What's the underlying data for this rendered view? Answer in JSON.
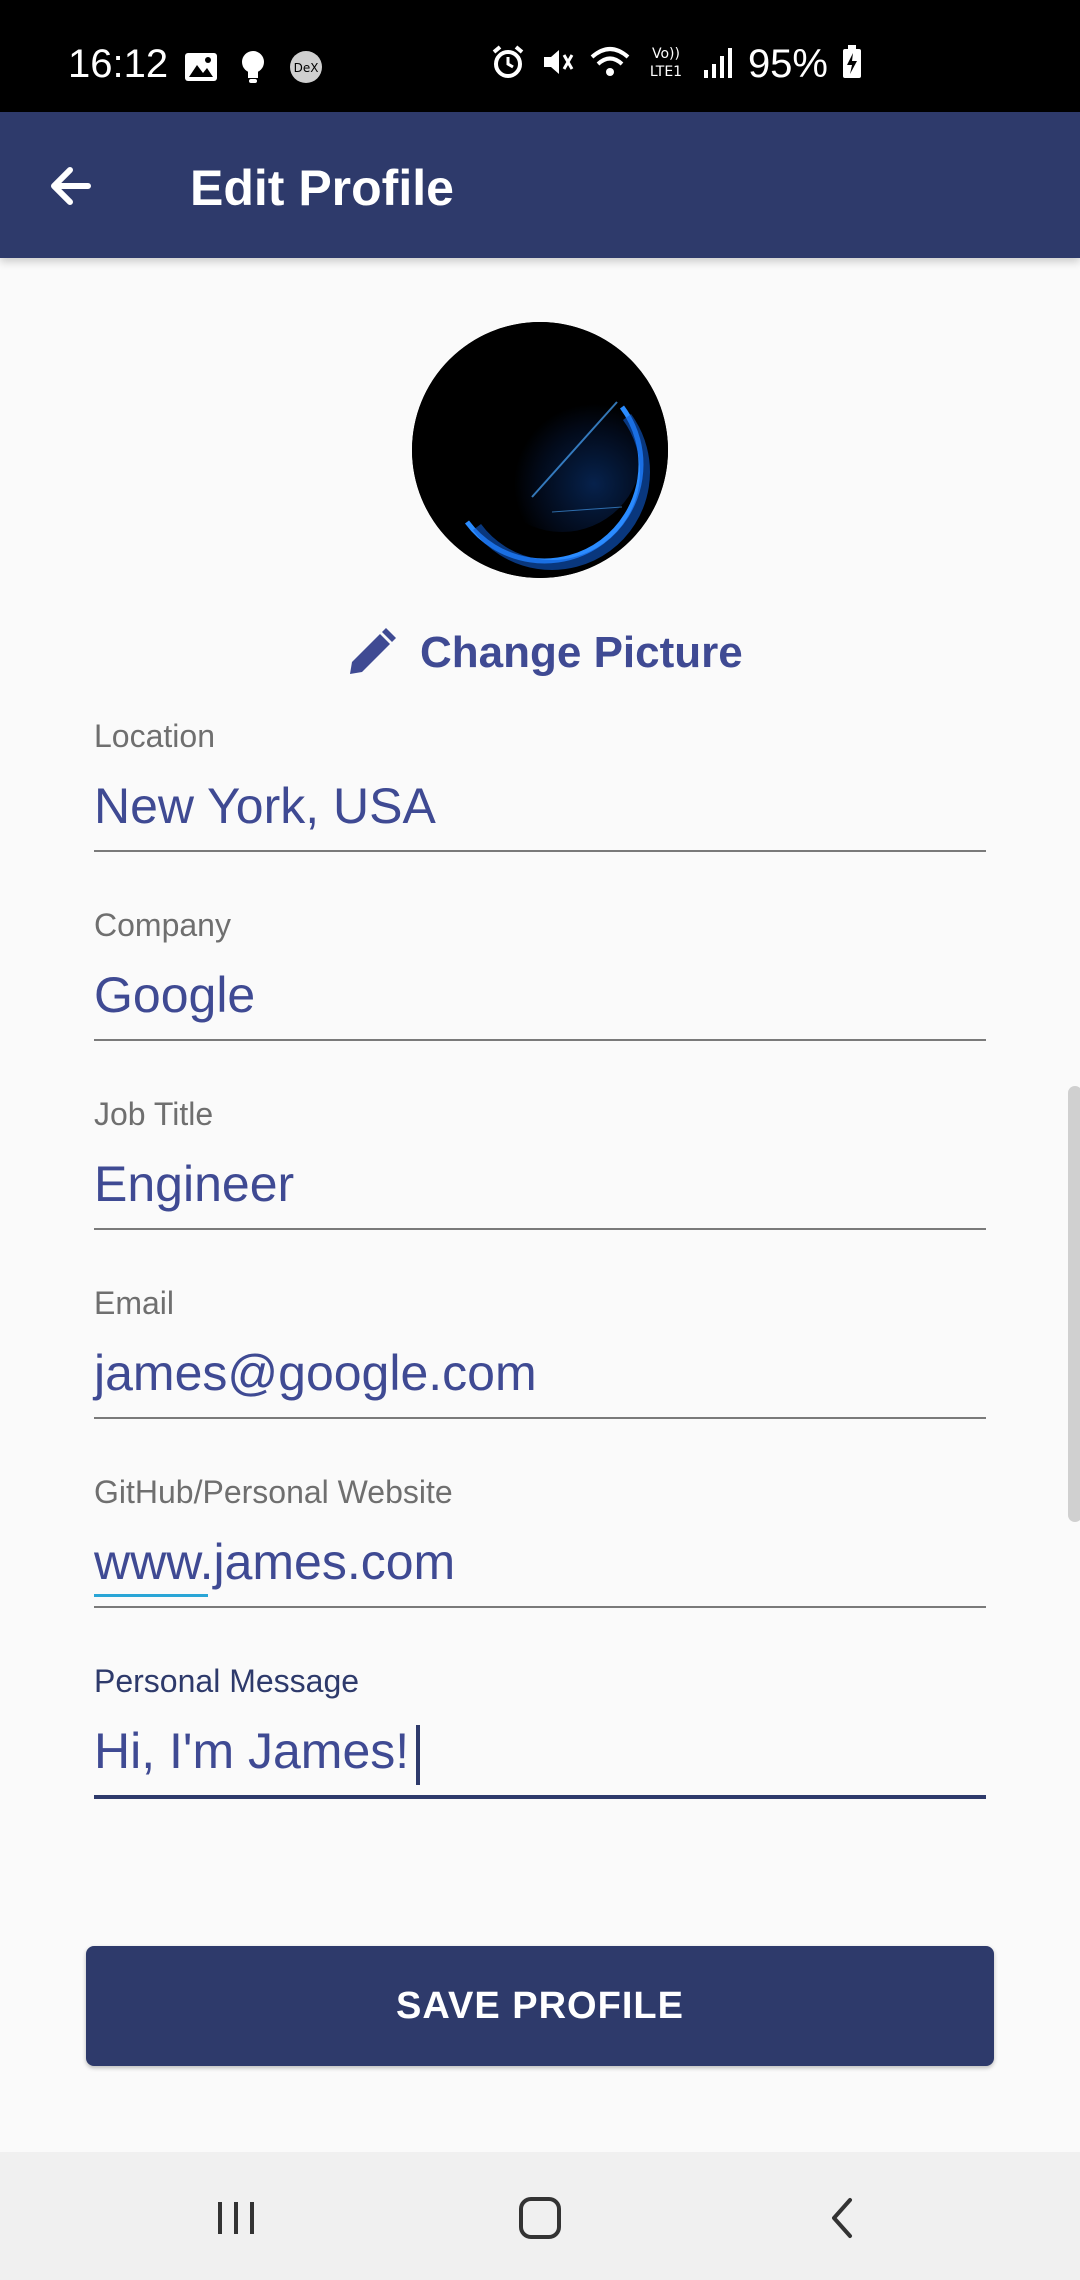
{
  "status_bar": {
    "time": "16:12",
    "battery_text": "95%",
    "icons_left": [
      "gallery-icon",
      "bulb-icon",
      "dex-icon"
    ],
    "icons_right": [
      "alarm-icon",
      "mute-icon",
      "wifi-icon",
      "volte-icon",
      "signal-icon",
      "battery-charging-icon"
    ],
    "volte_label": "Vo)) LTE1",
    "dex_label": "DeX"
  },
  "app_bar": {
    "title": "Edit Profile",
    "back_icon": "arrow-left-icon",
    "background": "#2e3a6b"
  },
  "avatar": {
    "alt": "profile picture"
  },
  "change_picture": {
    "label": "Change Picture",
    "icon": "pencil-icon"
  },
  "form": {
    "fields": [
      {
        "label": "Location",
        "value": "New York, USA"
      },
      {
        "label": "Company",
        "value": "Google"
      },
      {
        "label": "Job Title",
        "value": "Engineer"
      },
      {
        "label": "Email",
        "value": "james@google.com"
      },
      {
        "label": "GitHub/Personal Website",
        "value": "www.james.com"
      },
      {
        "label": "Personal Message",
        "value": "Hi, I'm James!",
        "focused": true
      }
    ]
  },
  "save_button": {
    "label": "SAVE PROFILE"
  },
  "nav_bar": {
    "items": [
      "recents-icon",
      "home-icon",
      "back-icon"
    ]
  },
  "colors": {
    "primary": "#2e3a6b",
    "accent_text": "#3f4a93",
    "label_gray": "#6f6f6f",
    "background": "#fafafa"
  }
}
